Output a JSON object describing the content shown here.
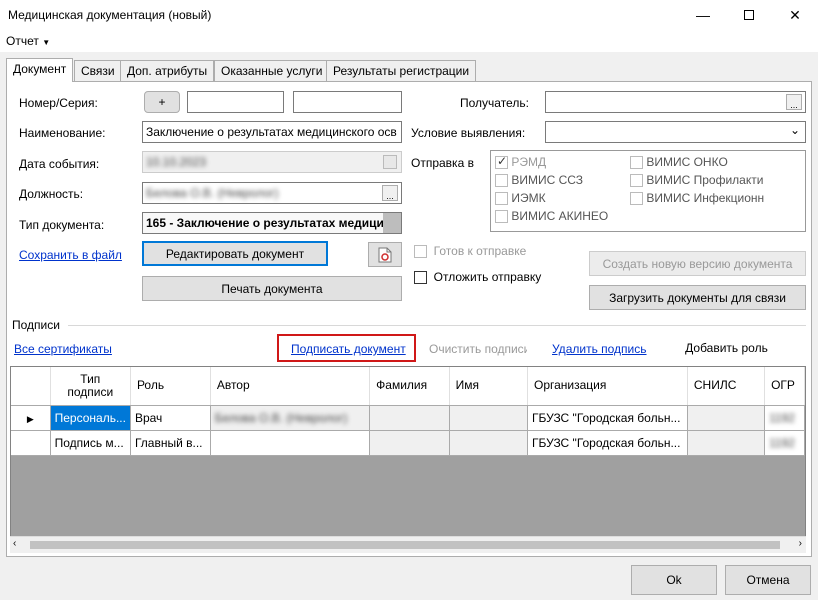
{
  "window": {
    "title": "Медицинская документация (новый)"
  },
  "menu": {
    "report": "Отчет"
  },
  "tabs": [
    "Документ",
    "Связи",
    "Доп. атрибуты",
    "Оказанные услуги",
    "Результаты регистрации"
  ],
  "form": {
    "number_label": "Номер/Серия:",
    "plus": "+",
    "name_label": "Наименование:",
    "name_value": "Заключение о результатах медицинского осв",
    "event_date_label": "Дата события:",
    "event_date_value": "10.10.2023",
    "position_label": "Должность:",
    "position_value": "Белова О.В. (Невролог)",
    "doc_type_label": "Тип документа:",
    "doc_type_value": "165 - Заключение о результатах медици",
    "save_to_file": "Сохранить в файл",
    "edit_document": "Редактировать документ",
    "print_document": "Печать документа",
    "recipient_label": "Получатель:",
    "condition_label": "Условие выявления:",
    "send_to_label": "Отправка в",
    "send_targets": [
      {
        "label": "РЭМД",
        "checked": true,
        "enabled": false
      },
      {
        "label": "ВИМИС ОНКО",
        "checked": false,
        "enabled": false
      },
      {
        "label": "ВИМИС ССЗ",
        "checked": false,
        "enabled": false
      },
      {
        "label": "ВИМИС Профилакти",
        "checked": false,
        "enabled": false
      },
      {
        "label": "ИЭМК",
        "checked": false,
        "enabled": false
      },
      {
        "label": "ВИМИС Инфекционн",
        "checked": false,
        "enabled": false
      },
      {
        "label": "ВИМИС АКИНЕО",
        "checked": false,
        "enabled": false
      }
    ],
    "ready_to_send": "Готов к отправке",
    "postpone_send": "Отложить отправку",
    "create_new_version": "Создать новую версию документа",
    "load_documents": "Загрузить документы для связи"
  },
  "signatures": {
    "section_label": "Подписи",
    "all_certificates": "Все сертификаты",
    "sign_document": "Подписать документ",
    "clear_signature": "Очистить подписи",
    "delete_signature": "Удалить подпись",
    "add_role": "Добавить роль",
    "columns": [
      "Тип подписи",
      "Роль",
      "Автор",
      "Фамилия",
      "Имя",
      "Организация",
      "СНИЛС",
      "ОГР"
    ],
    "rows": [
      {
        "type": "Персональ...",
        "role": "Врач",
        "author": "Белова О.В. (Невролог)",
        "surname": "",
        "name": "",
        "org": "ГБУЗС \"Городская больн...",
        "snils": "",
        "ogr": "1192"
      },
      {
        "type": "Подпись м...",
        "role": "Главный в...",
        "author": "",
        "surname": "",
        "name": "",
        "org": "ГБУЗС \"Городская больн...",
        "snils": "",
        "ogr": "1192"
      }
    ]
  },
  "footer": {
    "ok": "Ok",
    "cancel": "Отмена"
  }
}
